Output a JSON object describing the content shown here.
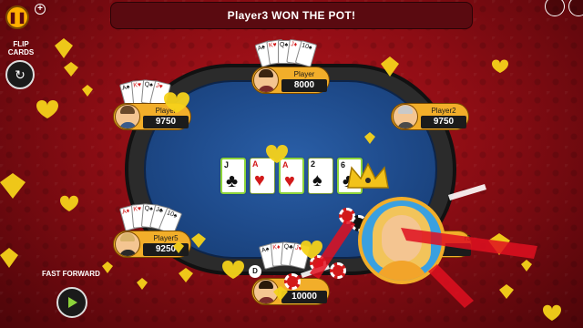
{
  "banner": {
    "message": "Player3 WON THE POT!"
  },
  "top_left": {
    "pause_icon": "pause-icon",
    "add_icon": "plus-icon"
  },
  "flip_cards": {
    "label_line1": "FLIP",
    "label_line2": "CARDS",
    "icon": "flip-cards-icon"
  },
  "fast_forward": {
    "label": "FAST FORWARD",
    "icon": "play-icon"
  },
  "players": [
    {
      "id": "top",
      "name": "Player",
      "chips": "8000"
    },
    {
      "id": "left-top",
      "name": "Player",
      "chips": "9750"
    },
    {
      "id": "right-top",
      "name": "Player2",
      "chips": "9750"
    },
    {
      "id": "left-bottom",
      "name": "Player5",
      "chips": "9250"
    },
    {
      "id": "bottom",
      "name": "",
      "chips": "10000"
    },
    {
      "id": "right-bottom",
      "name": "r3",
      "chips": ""
    }
  ],
  "dealer_button": "D",
  "community_cards": [
    {
      "rank": "J",
      "suit": "♣",
      "color": "black"
    },
    {
      "rank": "A",
      "suit": "♥",
      "color": "red"
    },
    {
      "rank": "A",
      "suit": "♥",
      "color": "red"
    },
    {
      "rank": "2",
      "suit": "♠",
      "color": "black"
    },
    {
      "rank": "6",
      "suit": "♣",
      "color": "black"
    }
  ],
  "colors": {
    "accent": "#f2ae2a",
    "felt": "#1e4a8a",
    "background": "#8d0d14",
    "win_highlight": "#8dd43a"
  }
}
